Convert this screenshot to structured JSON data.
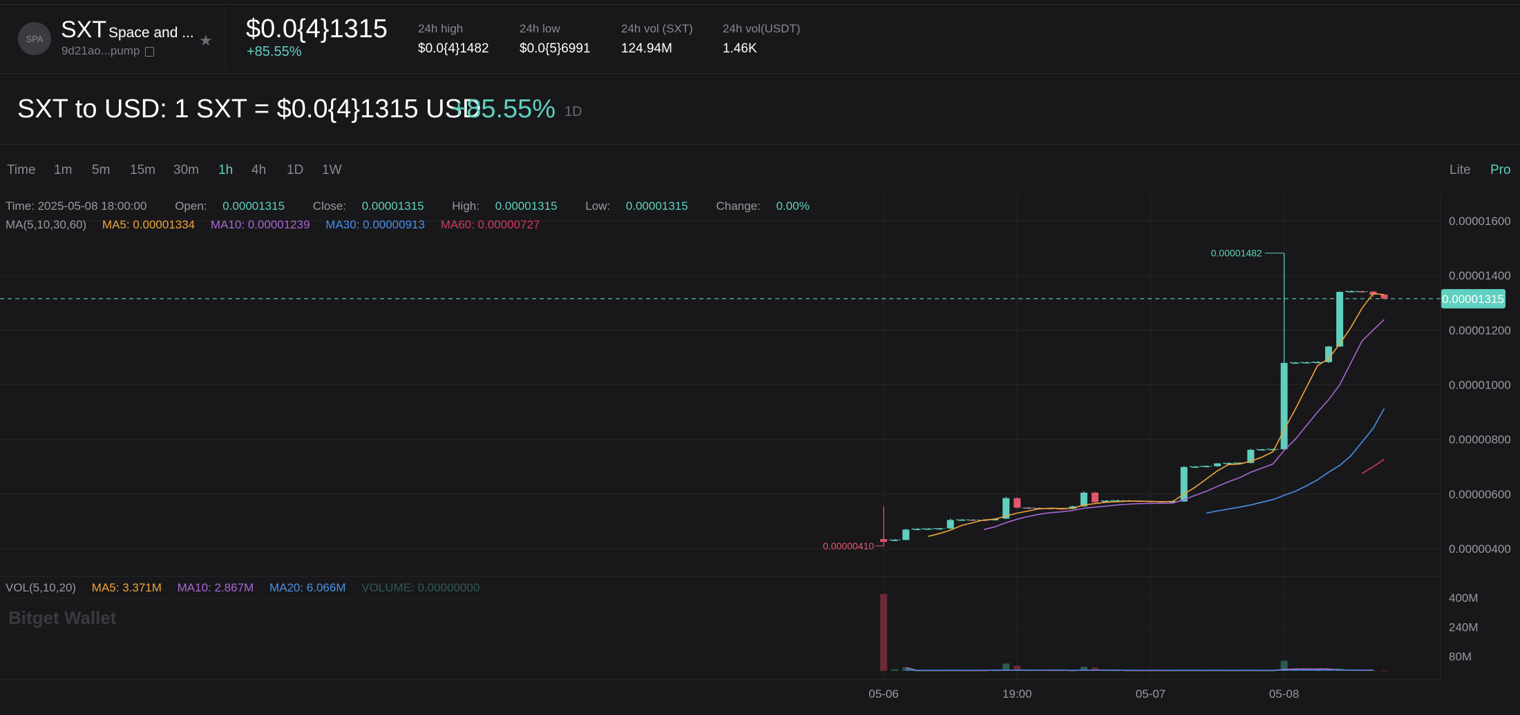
{
  "header": {
    "avatar_text": "SPA",
    "symbol": "SXT",
    "token_name": "Space and ...",
    "address": "9d21ao...pump",
    "price": "$0.0{4}1315",
    "change": "+85.55%",
    "stats": [
      {
        "label": "24h high",
        "value": "$0.0{4}1482"
      },
      {
        "label": "24h low",
        "value": "$0.0{5}6991"
      },
      {
        "label": "24h vol (SXT)",
        "value": "124.94M"
      },
      {
        "label": "24h vol(USDT)",
        "value": "1.46K"
      }
    ]
  },
  "title_row": {
    "text": "SXT to USD: 1 SXT = $0.0{4}1315 USD",
    "change": "+85.55%",
    "period": "1D"
  },
  "timeframes": [
    "Time",
    "1m",
    "5m",
    "15m",
    "30m",
    "1h",
    "4h",
    "1D",
    "1W"
  ],
  "active_timeframe": "1h",
  "modes": {
    "lite": "Lite",
    "pro": "Pro"
  },
  "info": {
    "time": "Time: 2025-05-08 18:00:00",
    "open_label": "Open:",
    "open": "0.00001315",
    "close_label": "Close:",
    "close": "0.00001315",
    "high_label": "High:",
    "high": "0.00001315",
    "low_label": "Low:",
    "low": "0.00001315",
    "change_label": "Change:",
    "change": "0.00%"
  },
  "ma_info": {
    "label": "MA(5,10,30,60)",
    "ma5": "MA5: 0.00001334",
    "ma10": "MA10: 0.00001239",
    "ma30": "MA30: 0.00000913",
    "ma60": "MA60: 0.00000727"
  },
  "vol_info": {
    "label": "VOL(5,10,20)",
    "ma5": "MA5: 3.371M",
    "ma10": "MA10: 2.867M",
    "ma20": "MA20: 6.066M",
    "volume": "VOLUME: 0.00000000"
  },
  "watermark": "Bitget Wallet",
  "colors": {
    "up": "#5fd0c0",
    "down": "#e2566f",
    "ma5": "#f0a53c",
    "ma10": "#a867d6",
    "ma30": "#4a8fe7",
    "ma60": "#d23a5e"
  },
  "chart_data": {
    "type": "candlestick",
    "interval": "1h",
    "y_ticks": [
      "0.00001600",
      "0.00001400",
      "0.00001200",
      "0.00001000",
      "0.00000800",
      "0.00000600",
      "0.00000400"
    ],
    "x_ticks": [
      {
        "label": "05-06",
        "i": 0
      },
      {
        "label": "19:00",
        "i": 12
      },
      {
        "label": "05-07",
        "i": 24
      },
      {
        "label": "05-08",
        "i": 36
      }
    ],
    "vol_ticks": [
      "400M",
      "240M",
      "80M"
    ],
    "last_price": "0.00001315",
    "high_label": "0.00001482",
    "low_label": "0.00000410",
    "candles": [
      {
        "o": 4.35,
        "c": 4.25,
        "h": 5.55,
        "l": 4.1
      },
      {
        "o": 4.3,
        "c": 4.32,
        "h": 4.35,
        "l": 4.28
      },
      {
        "o": 4.32,
        "c": 4.7,
        "h": 4.72,
        "l": 4.3
      },
      {
        "o": 4.7,
        "c": 4.72,
        "h": 4.74,
        "l": 4.68
      },
      {
        "o": 4.72,
        "c": 4.73,
        "h": 4.75,
        "l": 4.7
      },
      {
        "o": 4.73,
        "c": 4.74,
        "h": 4.76,
        "l": 4.72
      },
      {
        "o": 4.74,
        "c": 5.05,
        "h": 5.1,
        "l": 4.72
      },
      {
        "o": 5.05,
        "c": 5.06,
        "h": 5.07,
        "l": 5.03
      },
      {
        "o": 5.06,
        "c": 5.05,
        "h": 5.08,
        "l": 5.03
      },
      {
        "o": 5.05,
        "c": 5.04,
        "h": 5.07,
        "l": 5.02
      },
      {
        "o": 5.04,
        "c": 5.1,
        "h": 5.12,
        "l": 5.03
      },
      {
        "o": 5.1,
        "c": 5.85,
        "h": 5.9,
        "l": 5.08
      },
      {
        "o": 5.85,
        "c": 5.5,
        "h": 5.88,
        "l": 5.48
      },
      {
        "o": 5.5,
        "c": 5.49,
        "h": 5.52,
        "l": 5.47
      },
      {
        "o": 5.49,
        "c": 5.48,
        "h": 5.51,
        "l": 5.46
      },
      {
        "o": 5.48,
        "c": 5.47,
        "h": 5.5,
        "l": 5.45
      },
      {
        "o": 5.47,
        "c": 5.46,
        "h": 5.49,
        "l": 5.44
      },
      {
        "o": 5.46,
        "c": 5.55,
        "h": 5.57,
        "l": 5.44
      },
      {
        "o": 5.55,
        "c": 6.05,
        "h": 6.1,
        "l": 5.53
      },
      {
        "o": 6.05,
        "c": 5.7,
        "h": 6.08,
        "l": 5.68
      },
      {
        "o": 5.7,
        "c": 5.75,
        "h": 5.77,
        "l": 5.68
      },
      {
        "o": 5.75,
        "c": 5.76,
        "h": 5.78,
        "l": 5.73
      },
      {
        "o": 5.76,
        "c": 5.75,
        "h": 5.78,
        "l": 5.73
      },
      {
        "o": 5.75,
        "c": 5.74,
        "h": 5.77,
        "l": 5.72
      },
      {
        "o": 5.74,
        "c": 5.73,
        "h": 5.76,
        "l": 5.71
      },
      {
        "o": 5.73,
        "c": 5.72,
        "h": 5.75,
        "l": 5.7
      },
      {
        "o": 5.72,
        "c": 5.73,
        "h": 5.75,
        "l": 5.7
      },
      {
        "o": 5.73,
        "c": 6.99,
        "h": 7.02,
        "l": 5.71
      },
      {
        "o": 6.99,
        "c": 7.0,
        "h": 7.02,
        "l": 6.97
      },
      {
        "o": 7.0,
        "c": 7.02,
        "h": 7.04,
        "l": 6.98
      },
      {
        "o": 7.02,
        "c": 7.12,
        "h": 7.14,
        "l": 7.0
      },
      {
        "o": 7.12,
        "c": 7.13,
        "h": 7.15,
        "l": 7.1
      },
      {
        "o": 7.13,
        "c": 7.14,
        "h": 7.16,
        "l": 7.11
      },
      {
        "o": 7.14,
        "c": 7.62,
        "h": 7.65,
        "l": 7.12
      },
      {
        "o": 7.62,
        "c": 7.63,
        "h": 7.65,
        "l": 7.6
      },
      {
        "o": 7.63,
        "c": 7.64,
        "h": 7.66,
        "l": 7.61
      },
      {
        "o": 7.64,
        "c": 10.8,
        "h": 14.82,
        "l": 7.6
      },
      {
        "o": 10.8,
        "c": 10.81,
        "h": 10.83,
        "l": 10.78
      },
      {
        "o": 10.81,
        "c": 10.82,
        "h": 10.84,
        "l": 10.79
      },
      {
        "o": 10.82,
        "c": 10.83,
        "h": 10.85,
        "l": 10.8
      },
      {
        "o": 10.83,
        "c": 11.4,
        "h": 11.42,
        "l": 10.8
      },
      {
        "o": 11.4,
        "c": 13.4,
        "h": 13.42,
        "l": 11.38
      },
      {
        "o": 13.4,
        "c": 13.42,
        "h": 13.44,
        "l": 13.38
      },
      {
        "o": 13.42,
        "c": 13.41,
        "h": 13.44,
        "l": 13.39
      },
      {
        "o": 13.41,
        "c": 13.3,
        "h": 13.43,
        "l": 13.2
      },
      {
        "o": 13.3,
        "c": 13.15,
        "h": 13.32,
        "l": 13.13
      }
    ],
    "price_unit": "1e-6",
    "volumes_M": [
      420,
      8,
      18,
      2,
      2,
      2,
      3,
      2,
      2,
      2,
      2,
      40,
      28,
      3,
      3,
      2,
      2,
      3,
      22,
      18,
      3,
      2,
      2,
      2,
      2,
      2,
      2,
      4,
      3,
      2,
      3,
      2,
      2,
      3,
      2,
      2,
      55,
      8,
      5,
      3,
      4,
      12,
      5,
      3,
      3,
      3
    ],
    "ma5": [
      null,
      null,
      null,
      null,
      4.45,
      4.55,
      4.68,
      4.85,
      4.95,
      5.05,
      5.08,
      5.2,
      5.3,
      5.38,
      5.46,
      5.48,
      5.47,
      5.48,
      5.6,
      5.65,
      5.7,
      5.72,
      5.74,
      5.74,
      5.73,
      5.72,
      5.73,
      6.0,
      6.25,
      6.55,
      6.85,
      7.08,
      7.1,
      7.2,
      7.35,
      7.55,
      8.35,
      9.1,
      9.9,
      10.7,
      10.95,
      11.5,
      12.1,
      12.8,
      13.34,
      13.3
    ],
    "ma10": [
      null,
      null,
      null,
      null,
      null,
      null,
      null,
      null,
      null,
      4.7,
      4.8,
      4.95,
      5.08,
      5.18,
      5.26,
      5.32,
      5.35,
      5.4,
      5.48,
      5.52,
      5.56,
      5.6,
      5.63,
      5.65,
      5.66,
      5.66,
      5.67,
      5.8,
      5.95,
      6.1,
      6.28,
      6.45,
      6.6,
      6.8,
      6.95,
      7.1,
      7.6,
      8.0,
      8.5,
      9.0,
      9.45,
      10.0,
      10.8,
      11.6,
      12.0,
      12.39
    ],
    "ma30": [
      null,
      null,
      null,
      null,
      null,
      null,
      null,
      null,
      null,
      null,
      null,
      null,
      null,
      null,
      null,
      null,
      null,
      null,
      null,
      null,
      null,
      null,
      null,
      null,
      null,
      null,
      null,
      null,
      null,
      5.3,
      5.38,
      5.45,
      5.52,
      5.6,
      5.7,
      5.8,
      5.95,
      6.1,
      6.3,
      6.52,
      6.8,
      7.05,
      7.4,
      7.9,
      8.4,
      9.13
    ],
    "ma60": [
      null,
      null,
      null,
      null,
      null,
      null,
      null,
      null,
      null,
      null,
      null,
      null,
      null,
      null,
      null,
      null,
      null,
      null,
      null,
      null,
      null,
      null,
      null,
      null,
      null,
      null,
      null,
      null,
      null,
      null,
      null,
      null,
      null,
      null,
      null,
      null,
      null,
      null,
      null,
      null,
      null,
      null,
      null,
      6.75,
      7.0,
      7.27
    ]
  }
}
